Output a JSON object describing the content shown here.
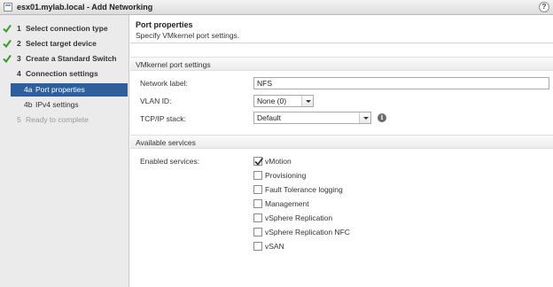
{
  "window": {
    "title": "esx01.mylab.local - Add Networking"
  },
  "steps": [
    {
      "num": "1",
      "label": "Select connection type",
      "status": "done"
    },
    {
      "num": "2",
      "label": "Select target device",
      "status": "done"
    },
    {
      "num": "3",
      "label": "Create a Standard Switch",
      "status": "done"
    },
    {
      "num": "4",
      "label": "Connection settings",
      "status": "current"
    },
    {
      "num": "4a",
      "label": "Port properties",
      "status": "active"
    },
    {
      "num": "4b",
      "label": "IPv4 settings",
      "status": "pending"
    },
    {
      "num": "5",
      "label": "Ready to complete",
      "status": "disabled"
    }
  ],
  "header": {
    "title": "Port properties",
    "subtitle": "Specify VMkernel port settings."
  },
  "port_settings": {
    "heading": "VMkernel port settings",
    "network_label": {
      "label": "Network label:",
      "value": "NFS"
    },
    "vlan": {
      "label": "VLAN ID:",
      "value": "None (0)"
    },
    "tcpip": {
      "label": "TCP/IP stack:",
      "value": "Default"
    }
  },
  "services": {
    "heading": "Available services",
    "label": "Enabled services:",
    "items": [
      {
        "label": "vMotion",
        "checked": true
      },
      {
        "label": "Provisioning",
        "checked": false
      },
      {
        "label": "Fault Tolerance logging",
        "checked": false
      },
      {
        "label": "Management",
        "checked": false
      },
      {
        "label": "vSphere Replication",
        "checked": false
      },
      {
        "label": "vSphere Replication NFC",
        "checked": false
      },
      {
        "label": "vSAN",
        "checked": false
      }
    ]
  },
  "colors": {
    "active_step": "#2f5f99",
    "check_green": "#3a9a2d"
  }
}
